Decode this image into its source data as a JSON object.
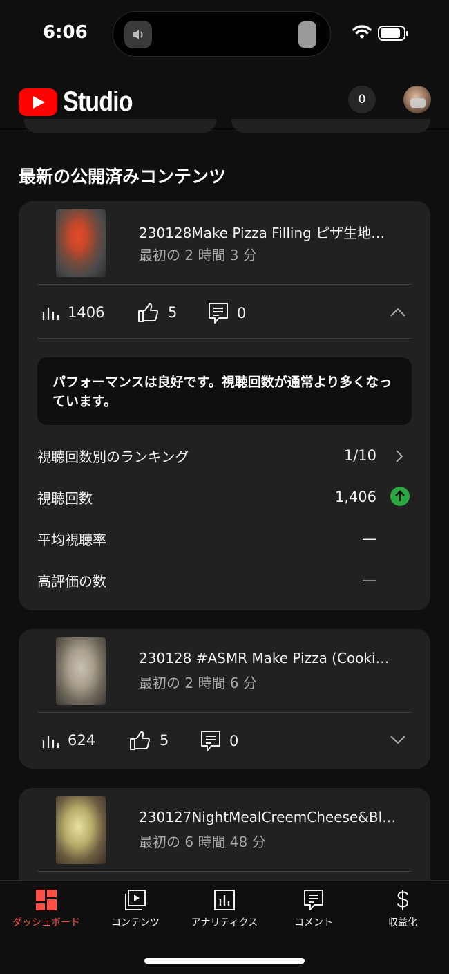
{
  "status_bar": {
    "time": "6:06"
  },
  "header": {
    "logo_text": "Studio",
    "notification_count": "0"
  },
  "section_title": "最新の公開済みコンテンツ",
  "videos": [
    {
      "title": "230128Make Pizza Filling ピザ生地…",
      "subtitle": "最初の 2 時間 3 分",
      "views": "1406",
      "likes": "5",
      "comments": "0",
      "expanded": true,
      "performance_message": "パフォーマンスは良好です。視聴回数が通常より多くなっています。",
      "metrics": [
        {
          "label": "視聴回数別のランキング",
          "value": "1/10"
        },
        {
          "label": "視聴回数",
          "value": "1,406"
        },
        {
          "label": "平均視聴率",
          "value": "—"
        },
        {
          "label": "高評価の数",
          "value": "—"
        }
      ]
    },
    {
      "title": "230128 #ASMR Make Pizza (Cooki…",
      "subtitle": "最初の 2 時間 6 分",
      "views": "624",
      "likes": "5",
      "comments": "0",
      "expanded": false
    },
    {
      "title": "230127NightMealCreemCheese&Bl…",
      "subtitle": "最初の 6 時間 48 分"
    }
  ],
  "bottom_nav": [
    {
      "label": "ダッシュボード",
      "icon": "dashboard-icon",
      "active": true
    },
    {
      "label": "コンテンツ",
      "icon": "content-icon",
      "active": false
    },
    {
      "label": "アナリティクス",
      "icon": "analytics-icon",
      "active": false
    },
    {
      "label": "コメント",
      "icon": "comment-icon",
      "active": false
    },
    {
      "label": "収益化",
      "icon": "dollar-icon",
      "active": false
    }
  ],
  "colors": {
    "accent": "#ff4e45",
    "positive": "#2ba640",
    "card": "#212121",
    "background": "#0f0f0f"
  }
}
